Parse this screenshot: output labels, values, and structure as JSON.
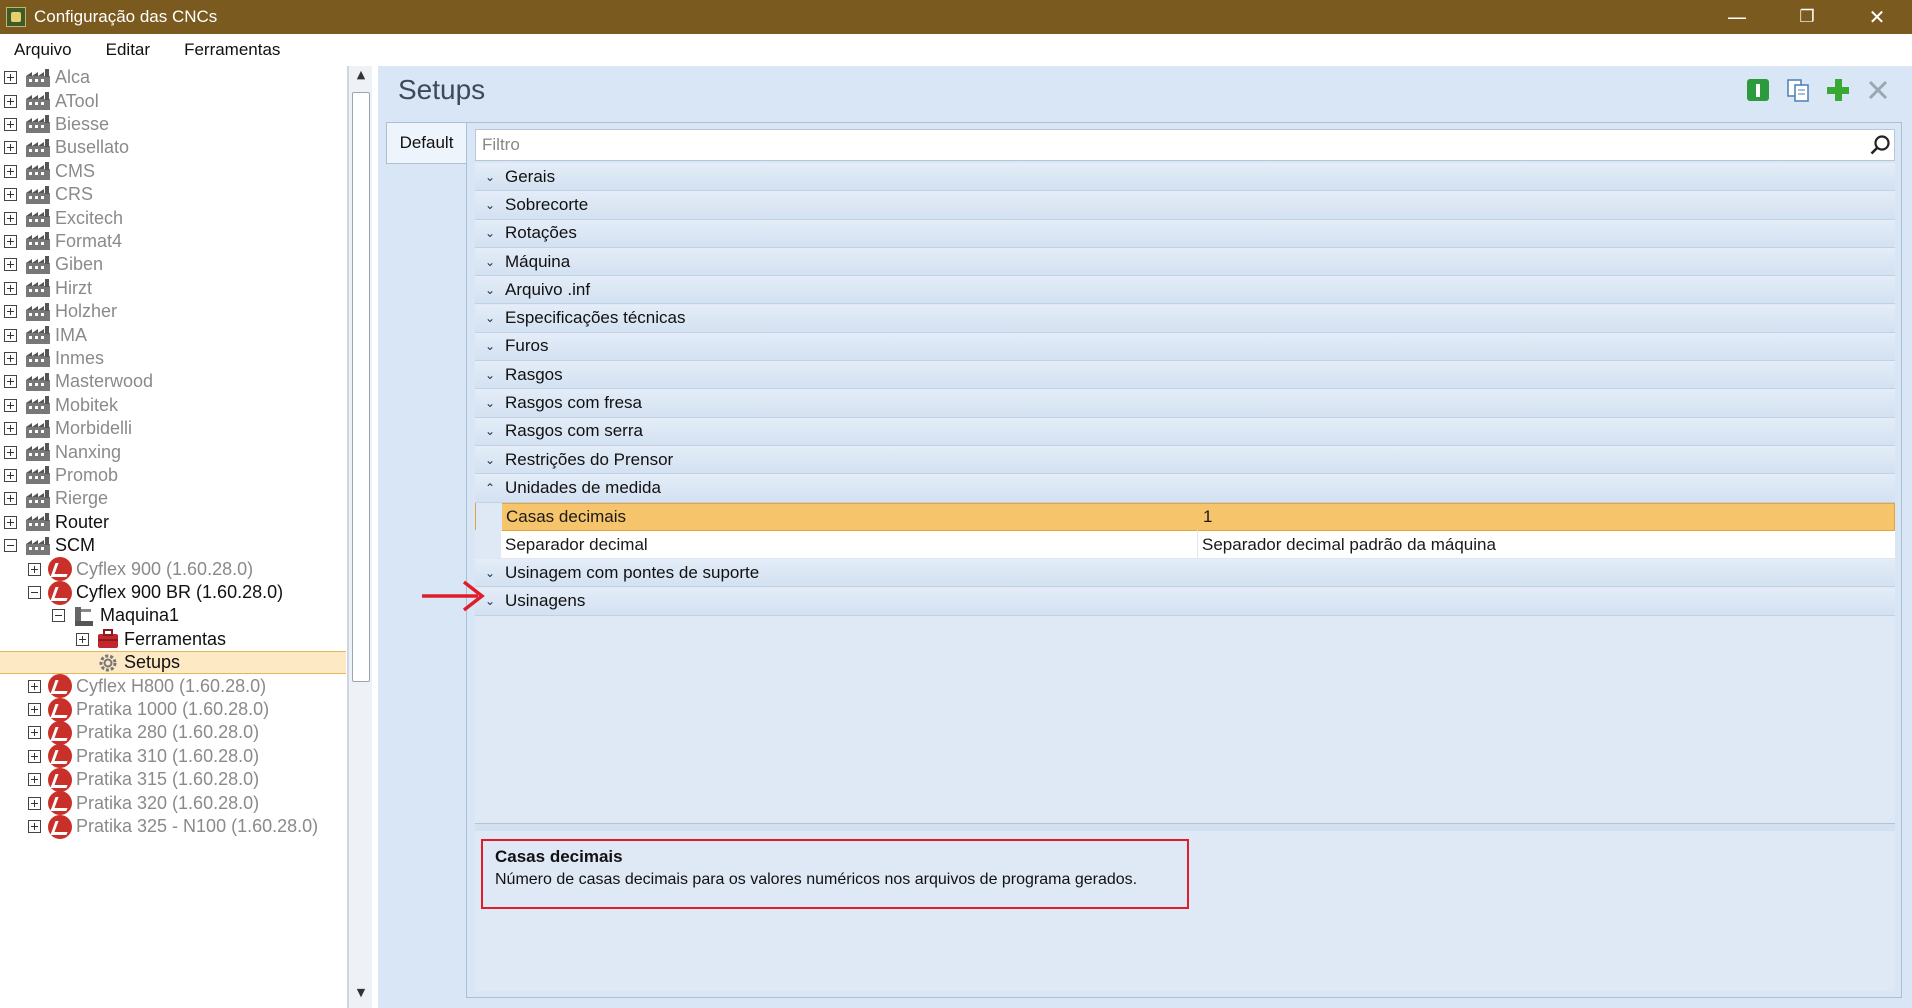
{
  "window": {
    "title": "Configuração das CNCs",
    "minimize": "—",
    "maximize": "❐",
    "close": "✕"
  },
  "menubar": {
    "items": [
      "Arquivo",
      "Editar",
      "Ferramentas"
    ]
  },
  "tree": {
    "manufacturers": [
      "Alca",
      "ATool",
      "Biesse",
      "Busellato",
      "CMS",
      "CRS",
      "Excitech",
      "Format4",
      "Giben",
      "Hirzt",
      "Holzher",
      "IMA",
      "Inmes",
      "Masterwood",
      "Mobitek",
      "Morbidelli",
      "Nanxing",
      "Promob",
      "Rierge",
      "Router",
      "SCM"
    ],
    "scm_children": {
      "cyflex900": "Cyflex 900 (1.60.28.0)",
      "cyflex900br": "Cyflex 900 BR (1.60.28.0)",
      "maquina1": "Maquina1",
      "ferramentas": "Ferramentas",
      "setups": "Setups",
      "others": [
        "Cyflex H800 (1.60.28.0)",
        "Pratika 1000 (1.60.28.0)",
        "Pratika 280 (1.60.28.0)",
        "Pratika 310 (1.60.28.0)",
        "Pratika 315 (1.60.28.0)",
        "Pratika 320 (1.60.28.0)",
        "Pratika 325 - N100 (1.60.28.0)"
      ]
    }
  },
  "main": {
    "title": "Setups",
    "tab": "Default",
    "filter_placeholder": "Filtro",
    "categories_before": [
      "Gerais",
      "Sobrecorte",
      "Rotações",
      "Máquina",
      "Arquivo .inf",
      "Especificações técnicas",
      "Furos",
      "Rasgos",
      "Rasgos com fresa",
      "Rasgos com serra",
      "Restrições do Prensor"
    ],
    "expanded_category": "Unidades de medida",
    "properties": [
      {
        "name": "Casas decimais",
        "value": "1"
      },
      {
        "name": "Separador decimal",
        "value": "Separador decimal padrão da máquina"
      }
    ],
    "categories_after": [
      "Usinagem com pontes de suporte",
      "Usinagens"
    ],
    "description": {
      "title": "Casas decimais",
      "text": "Número de casas decimais para os valores numéricos nos arquivos de programa gerados."
    }
  },
  "colors": {
    "titlebar": "#7a5a1e",
    "highlight": "#f6c46a",
    "annotation_red": "#e01e2b"
  }
}
